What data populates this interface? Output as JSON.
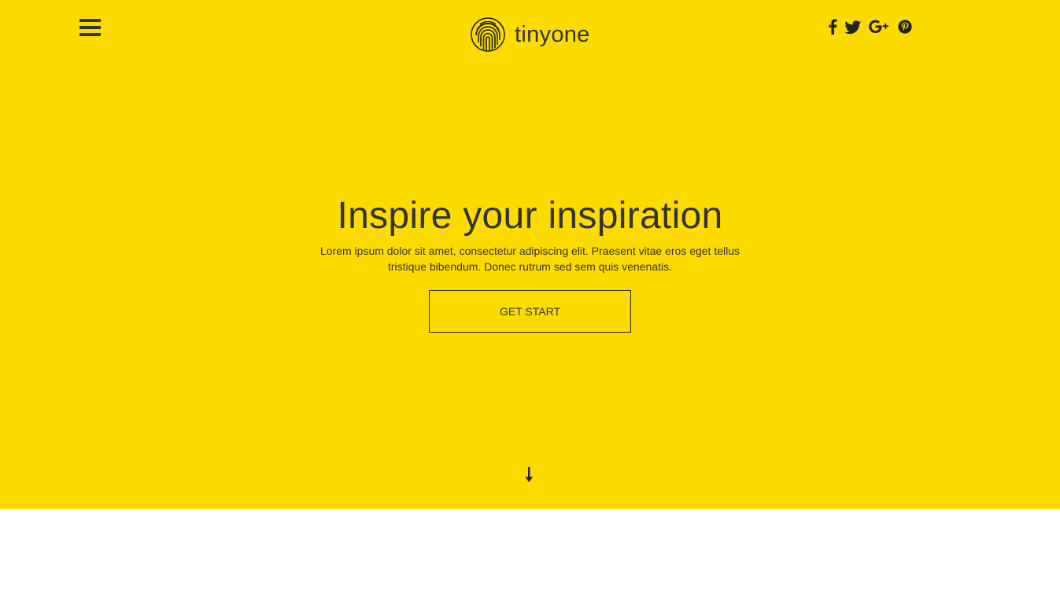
{
  "header": {
    "menu_icon": "hamburger-icon",
    "brand": {
      "logo_icon": "fingerprint-icon",
      "name": "tinyone"
    },
    "social": [
      {
        "name": "facebook",
        "icon": "facebook-icon"
      },
      {
        "name": "twitter",
        "icon": "twitter-icon"
      },
      {
        "name": "google-plus",
        "icon": "google-plus-icon"
      },
      {
        "name": "pinterest",
        "icon": "pinterest-icon"
      }
    ]
  },
  "hero": {
    "title": "Inspire your inspiration",
    "text": "Lorem ipsum dolor sit amet, consectetur adipiscing elit. Praesent vitae eros eget tellus tristique bibendum. Donec rutrum sed sem quis venenatis.",
    "cta_label": "GET START",
    "scroll_icon": "arrow-down-icon"
  },
  "colors": {
    "hero_background": "#fcdc00",
    "text": "#333333",
    "page_background": "#ffffff"
  }
}
